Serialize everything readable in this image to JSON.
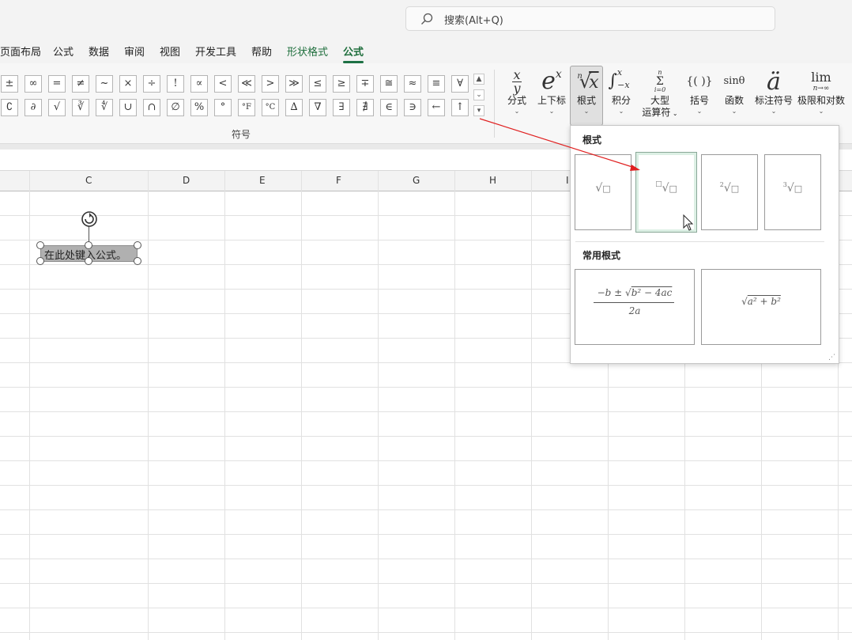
{
  "search": {
    "label": "搜索(Alt+Q)"
  },
  "menu_tabs": [
    {
      "label": "页面布局"
    },
    {
      "label": "公式"
    },
    {
      "label": "数据"
    },
    {
      "label": "审阅"
    },
    {
      "label": "视图"
    },
    {
      "label": "开发工具"
    },
    {
      "label": "帮助"
    },
    {
      "label": "形状格式"
    },
    {
      "label": "公式"
    }
  ],
  "symbols": {
    "row1": [
      "±",
      "∞",
      "=",
      "≠",
      "~",
      "×",
      "÷",
      "!",
      "∝",
      "<",
      "≪",
      ">",
      "≫",
      "≤",
      "≥",
      "∓",
      "≅",
      "≈",
      "≡",
      "∀"
    ],
    "row2": [
      "∁",
      "∂",
      "√",
      "∛",
      "∜",
      "∪",
      "∩",
      "∅",
      "%",
      "°",
      "°F",
      "°C",
      "∆",
      "∇",
      "∃",
      "∄",
      "∈",
      "∋",
      "←",
      "↑"
    ],
    "group_label": "符号"
  },
  "structures": [
    {
      "label": "分式"
    },
    {
      "label": "上下标"
    },
    {
      "label": "根式"
    },
    {
      "label": "积分"
    },
    {
      "label": "大型",
      "label2": "运算符"
    },
    {
      "label": "括号"
    },
    {
      "label": "函数"
    },
    {
      "label": "标注符号"
    },
    {
      "label": "极限和对数"
    }
  ],
  "columns": [
    "C",
    "D",
    "E",
    "F",
    "G",
    "H",
    "I"
  ],
  "shape_text": "在此处键入公式。",
  "gallery": {
    "section1_title": "根式",
    "section2_title": "常用根式"
  },
  "colors": {
    "accent_green": "#1e7145",
    "arrow_red": "#e02020"
  }
}
